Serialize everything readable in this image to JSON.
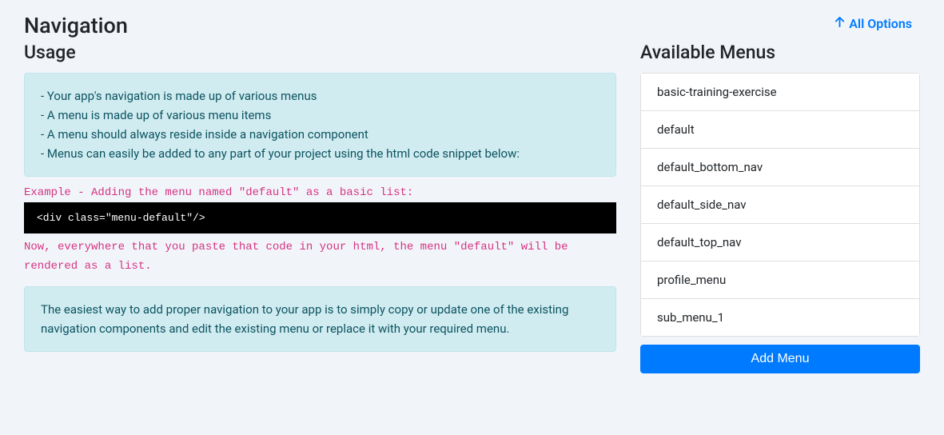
{
  "page": {
    "title": "Navigation"
  },
  "allOptions": {
    "label": "All Options"
  },
  "usage": {
    "title": "Usage",
    "bullets": {
      "b1": "- Your app's navigation is made up of various menus",
      "b2": "- A menu is made up of various menu items",
      "b3": "- A menu should always reside inside a navigation component",
      "b4": "- Menus can easily be added to any part of your project using the html code snippet below:"
    },
    "exampleLabel": "Example - Adding the menu named \"default\" as a basic list:",
    "codeSnippet": "<div class=\"menu-default\"/>",
    "postCodeText": "Now, everywhere that you paste that code in your html, the menu \"default\" will be rendered as a list.",
    "tip": "The easiest way to add proper navigation to your app is to simply copy or update one of the existing navigation components and edit the existing menu or replace it with your required menu."
  },
  "availableMenus": {
    "title": "Available Menus",
    "items": [
      "basic-training-exercise",
      "default",
      "default_bottom_nav",
      "default_side_nav",
      "default_top_nav",
      "profile_menu",
      "sub_menu_1"
    ],
    "addButtonLabel": "Add Menu"
  }
}
